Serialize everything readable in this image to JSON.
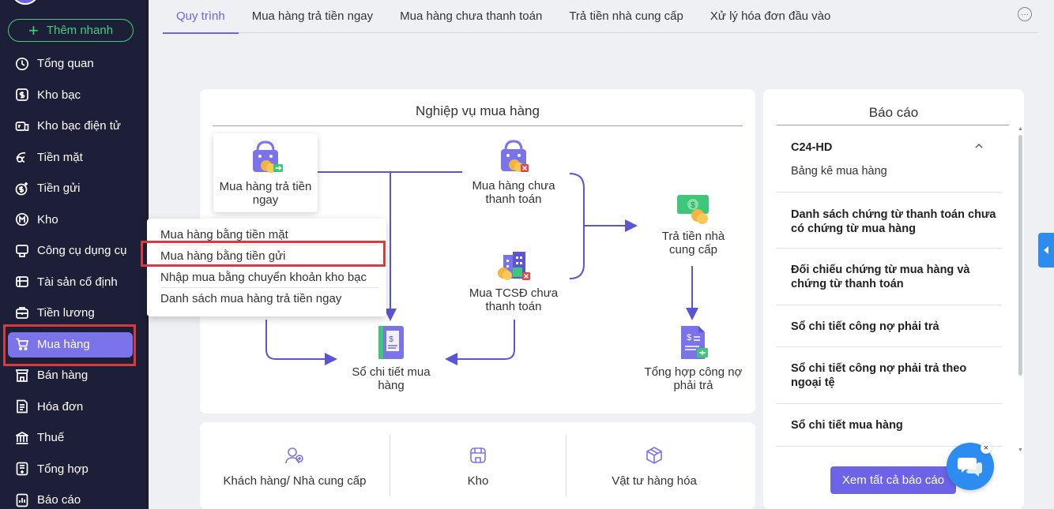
{
  "sidebar": {
    "quick_add_label": "Thêm nhanh",
    "items": [
      {
        "label": "Tổng quan",
        "icon": "clock-icon"
      },
      {
        "label": "Kho bạc",
        "icon": "treasury-icon"
      },
      {
        "label": "Kho bạc điện tử",
        "icon": "e-treasury-icon"
      },
      {
        "label": "Tiền mặt",
        "icon": "cash-icon"
      },
      {
        "label": "Tiền gửi",
        "icon": "deposit-icon"
      },
      {
        "label": "Kho",
        "icon": "warehouse-icon"
      },
      {
        "label": "Công cụ dụng cụ",
        "icon": "tools-icon"
      },
      {
        "label": "Tài sản cố định",
        "icon": "asset-icon"
      },
      {
        "label": "Tiền lương",
        "icon": "salary-icon"
      },
      {
        "label": "Mua hàng",
        "icon": "cart-icon",
        "active": true
      },
      {
        "label": "Bán hàng",
        "icon": "sales-icon"
      },
      {
        "label": "Hóa đơn",
        "icon": "invoice-icon"
      },
      {
        "label": "Thuế",
        "icon": "tax-icon"
      },
      {
        "label": "Tổng hợp",
        "icon": "summary-icon"
      },
      {
        "label": "Báo cáo",
        "icon": "report-icon"
      }
    ]
  },
  "tabs": [
    {
      "label": "Quy trình",
      "active": true
    },
    {
      "label": "Mua hàng trả tiền ngay"
    },
    {
      "label": "Mua hàng chưa thanh toán"
    },
    {
      "label": "Trả tiền nhà cung cấp"
    },
    {
      "label": "Xử lý hóa đơn đầu vào"
    }
  ],
  "process": {
    "title": "Nghiệp vụ mua hàng",
    "nodes": {
      "buy_pay_now": "Mua hàng trả tiền ngay",
      "buy_unpaid": "Mua hàng chưa thanh toán",
      "pay_supplier": "Trả tiền nhà cung cấp",
      "buy_fixed_asset": "Mua TCSĐ chưa thanh toán",
      "purchase_ledger": "Sổ chi tiết mua hàng",
      "payables_summary": "Tổng hợp công nợ phải trả"
    },
    "dropdown": [
      "Mua hàng bằng tiền mặt",
      "Mua hàng bằng tiền gửi",
      "Nhập mua bằng chuyển khoản kho bạc",
      "Danh sách mua hàng trả tiền ngay"
    ]
  },
  "bottom_links": [
    {
      "label": "Khách hàng/ Nhà cung cấp",
      "icon": "users-icon"
    },
    {
      "label": "Kho",
      "icon": "store-icon"
    },
    {
      "label": "Vật tư hàng hóa",
      "icon": "box-icon"
    }
  ],
  "reports": {
    "title": "Báo cáo",
    "group_title": "C24-HD",
    "group_sub": "Bảng kê mua hàng",
    "items": [
      "Danh sách chứng từ thanh toán chưa có chứng từ mua hàng",
      "Đối chiếu chứng từ mua hàng và chứng từ thanh toán",
      "Sổ chi tiết công nợ phải trả",
      "Sổ chi tiết công nợ phải trả theo ngoại tệ",
      "Sổ chi tiết mua hàng"
    ],
    "see_all_label": "Xem tất cả báo cáo"
  },
  "colors": {
    "sidebar_bg": "#1d1f38",
    "accent": "#6c63e6",
    "quick_add_green": "#3ed17a",
    "highlight_red": "#d93a3a",
    "chat_blue": "#2d8cf0"
  }
}
